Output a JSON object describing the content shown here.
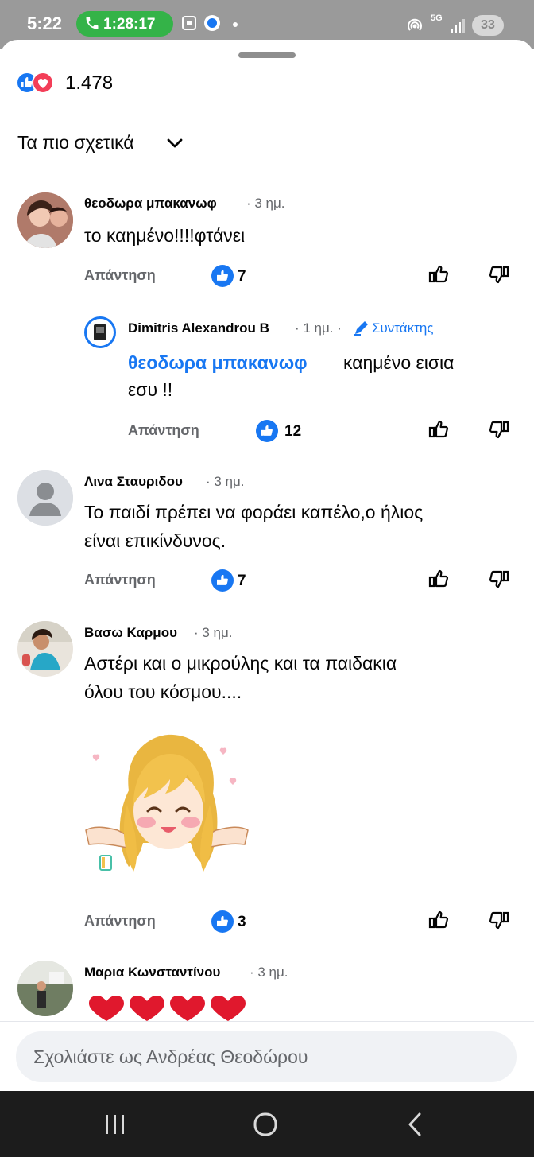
{
  "status_bar": {
    "time": "5:22",
    "call_timer": "1:28:17",
    "network": "5G",
    "battery": "33"
  },
  "reactions": {
    "count": "1.478",
    "types": [
      "like-icon",
      "love-icon"
    ]
  },
  "sort": {
    "label": "Τα πιο σχετικά"
  },
  "comments": [
    {
      "author": "θεοδωρα μπακανωφ",
      "time": "· 3 ημ.",
      "text": "το καημένο!!!!φτάνει",
      "reply_label": "Απάντηση",
      "likes": "7"
    },
    {
      "author": "Dimitris Alexandrou B",
      "time": "· 1 ημ. ·",
      "role": "Συντάκτης",
      "mention": "θεοδωρα μπακανωφ",
      "text": "καημένο εισια",
      "text_line2": "εσυ !!",
      "reply_label": "Απάντηση",
      "likes": "12"
    },
    {
      "author": "Λινα Σταυριδου",
      "time": "· 3 ημ.",
      "text": "Το παιδί πρέπει να φοράει καπέλο,ο ήλιος",
      "text_line2": "είναι επικίνδυνος.",
      "reply_label": "Απάντηση",
      "likes": "7"
    },
    {
      "author": "Βασω Καρμου",
      "time": "· 3 ημ.",
      "text": "Αστέρι και ο μικρούλης και τα παιδακια",
      "text_line2": "όλου του κόσμου....",
      "reply_label": "Απάντηση",
      "likes": "3"
    },
    {
      "author": "Μαρια Κωνσταντίνου",
      "time": "· 3 ημ."
    }
  ],
  "composer": {
    "placeholder": "Σχολιάστε ως Ανδρέας Θεοδώρου"
  },
  "colors": {
    "brand_blue": "#1877f2",
    "love_red": "#f33e58",
    "secondary_text": "#65676b"
  }
}
